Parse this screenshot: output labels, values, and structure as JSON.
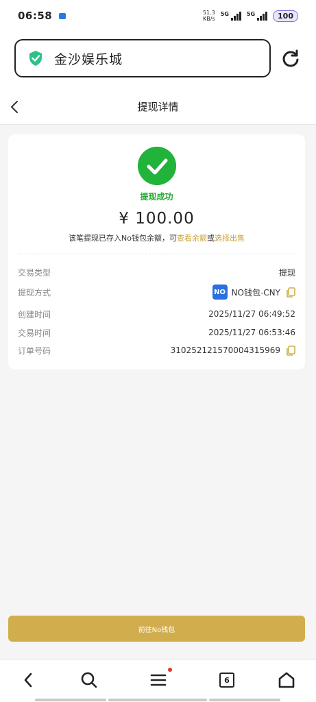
{
  "statusbar": {
    "time": "06:58",
    "speed_value": "51.3",
    "speed_unit": "KB/s",
    "sim1": "5G",
    "sim2": "5G",
    "battery": "100"
  },
  "browser": {
    "site_name": "金沙娱乐城"
  },
  "nav": {
    "title": "提现详情"
  },
  "result": {
    "status": "提现成功",
    "amount": "¥ 100.00",
    "note_prefix": "该笔提现已存入No钱包余额，可",
    "note_link1": "查看余额",
    "note_mid": "或",
    "note_link2": "选择出售"
  },
  "details": [
    {
      "label": "交易类型",
      "value": "提现"
    },
    {
      "label": "提现方式",
      "value": "NO钱包-CNY",
      "badge": "NO"
    },
    {
      "label": "创建时间",
      "value": "2025/11/27 06:49:52"
    },
    {
      "label": "交易时间",
      "value": "2025/11/27 06:53:46"
    },
    {
      "label": "订单号码",
      "value": "310252121570004315969"
    }
  ],
  "cta": {
    "label": "前往No钱包"
  },
  "bottombar": {
    "tab_count": "6"
  },
  "colors": {
    "accent": "#d1ad4d",
    "success": "#22b33a",
    "link": "#c9a23a"
  }
}
